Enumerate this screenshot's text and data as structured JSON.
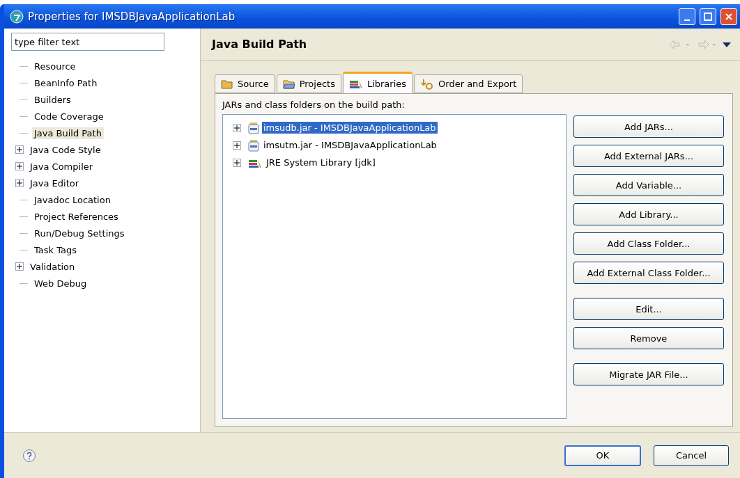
{
  "window": {
    "title": "Properties for IMSDBJavaApplicationLab"
  },
  "filter": {
    "placeholder": "type filter text"
  },
  "tree": [
    {
      "label": "Resource",
      "selected": false
    },
    {
      "label": "BeanInfo Path",
      "selected": false
    },
    {
      "label": "Builders",
      "selected": false
    },
    {
      "label": "Code Coverage",
      "selected": false
    },
    {
      "label": "Java Build Path",
      "selected": true
    },
    {
      "label": "Java Code Style",
      "selected": false,
      "expanded": false
    },
    {
      "label": "Java Compiler",
      "selected": false,
      "expanded": false
    },
    {
      "label": "Java Editor",
      "selected": false,
      "expanded": false
    },
    {
      "label": "Javadoc Location",
      "selected": false
    },
    {
      "label": "Project References",
      "selected": false
    },
    {
      "label": "Run/Debug Settings",
      "selected": false
    },
    {
      "label": "Task Tags",
      "selected": false
    },
    {
      "label": "Validation",
      "selected": false,
      "expanded": false
    },
    {
      "label": "Web Debug",
      "selected": false
    }
  ],
  "page": {
    "title": "Java Build Path"
  },
  "tabs": [
    {
      "label": "Source",
      "kind": "source",
      "selected": false
    },
    {
      "label": "Projects",
      "kind": "projects",
      "selected": false
    },
    {
      "label": "Libraries",
      "kind": "libraries",
      "selected": true
    },
    {
      "label": "Order and Export",
      "kind": "order",
      "selected": false
    }
  ],
  "list_label": "JARs and class folders on the build path:",
  "libraries": [
    {
      "label": "imsudb.jar - IMSDBJavaApplicationLab",
      "kind": "jar",
      "selected": true,
      "expanded": false
    },
    {
      "label": "imsutm.jar - IMSDBJavaApplicationLab",
      "kind": "jar",
      "selected": false,
      "expanded": false
    },
    {
      "label": "JRE System Library [jdk]",
      "kind": "library",
      "selected": false,
      "expanded": false
    }
  ],
  "button_groups": [
    [
      "Add JARs...",
      "Add External JARs...",
      "Add Variable...",
      "Add Library...",
      "Add Class Folder...",
      "Add External Class Folder..."
    ],
    [
      "Edit...",
      "Remove"
    ],
    [
      "Migrate JAR File..."
    ]
  ],
  "footer_buttons": [
    "OK",
    "Cancel"
  ]
}
